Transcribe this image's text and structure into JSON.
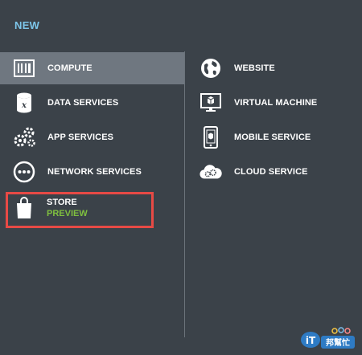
{
  "header": {
    "title": "NEW"
  },
  "left_items": [
    {
      "label": "COMPUTE",
      "icon": "compute-icon",
      "selected": true
    },
    {
      "label": "DATA SERVICES",
      "icon": "data-services-icon"
    },
    {
      "label": "APP SERVICES",
      "icon": "app-services-icon"
    },
    {
      "label": "NETWORK SERVICES",
      "icon": "network-services-icon"
    }
  ],
  "store": {
    "label": "STORE",
    "sublabel": "PREVIEW",
    "icon": "shopping-bag-icon"
  },
  "right_items": [
    {
      "label": "WEBSITE",
      "icon": "website-globe-icon"
    },
    {
      "label": "VIRTUAL MACHINE",
      "icon": "virtual-machine-icon"
    },
    {
      "label": "MOBILE SERVICE",
      "icon": "mobile-service-icon"
    },
    {
      "label": "CLOUD SERVICE",
      "icon": "cloud-service-icon"
    }
  ],
  "watermark": {
    "text": "iT邦幫忙"
  },
  "colors": {
    "background": "#3b4249",
    "selected": "#6f7780",
    "header": "#7dc6ea",
    "highlight_border": "#e74a45",
    "preview": "#7fbf3f"
  }
}
